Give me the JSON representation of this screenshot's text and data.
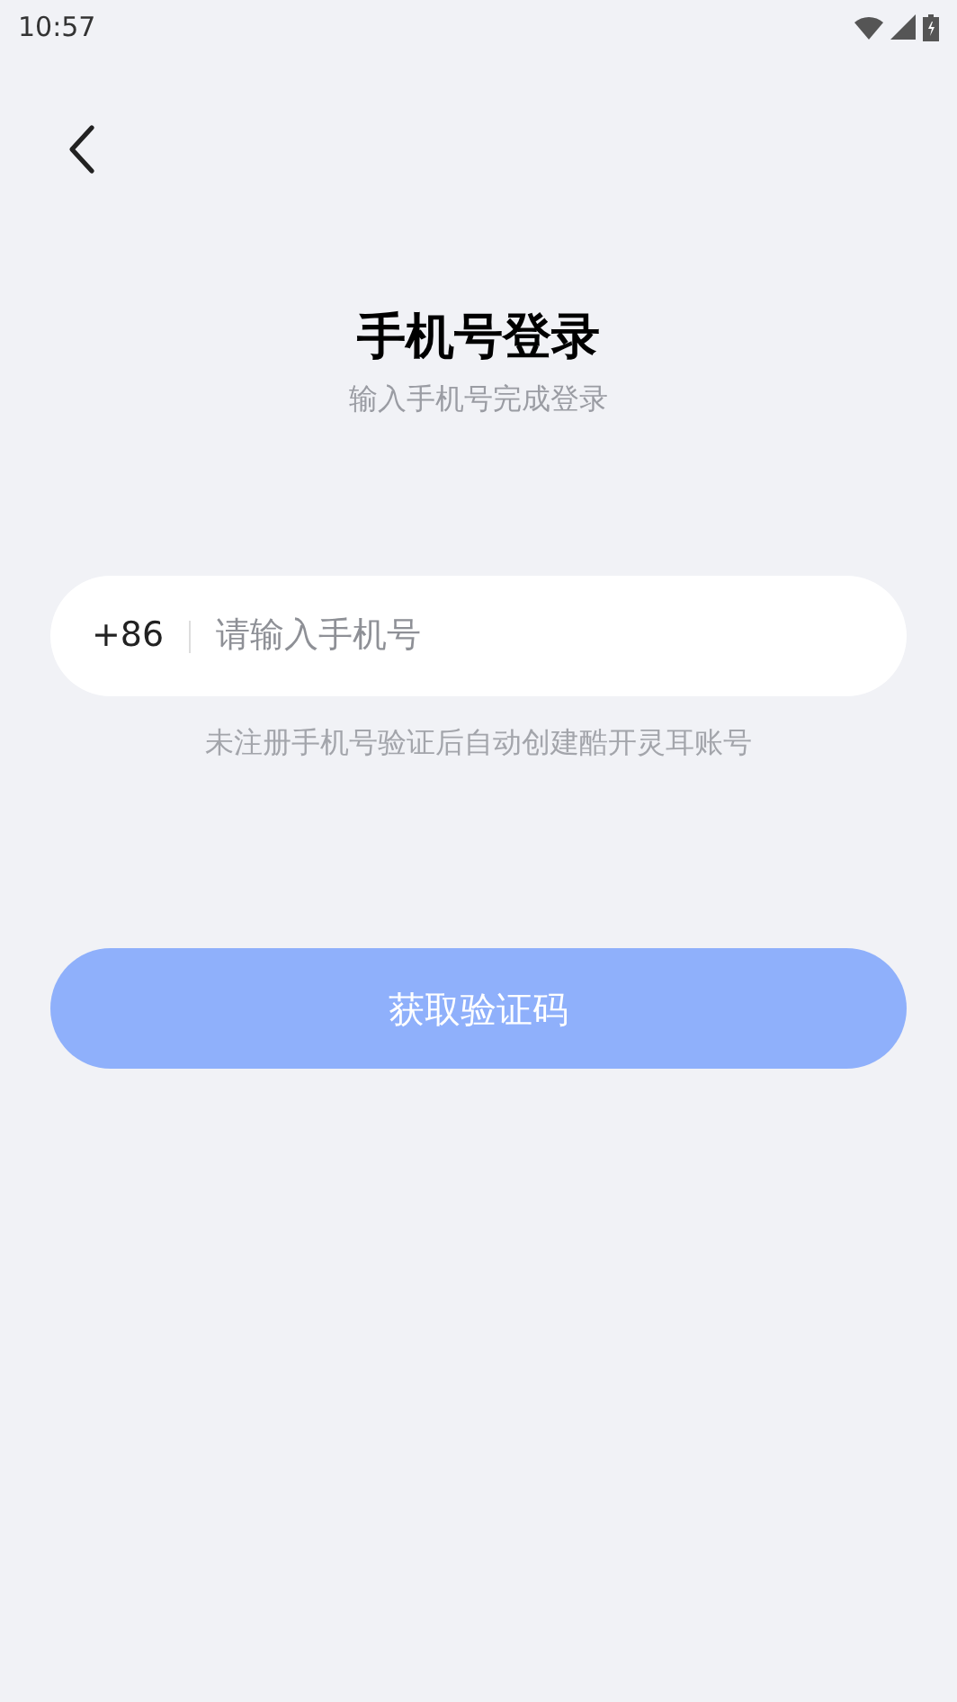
{
  "status_bar": {
    "time": "10:57"
  },
  "title": "手机号登录",
  "subtitle": "输入手机号完成登录",
  "phone_field": {
    "country_code": "+86",
    "placeholder": "请输入手机号"
  },
  "hint": "未注册手机号验证后自动创建酷开灵耳账号",
  "submit_button": {
    "label": "获取验证码",
    "disabled": true
  }
}
